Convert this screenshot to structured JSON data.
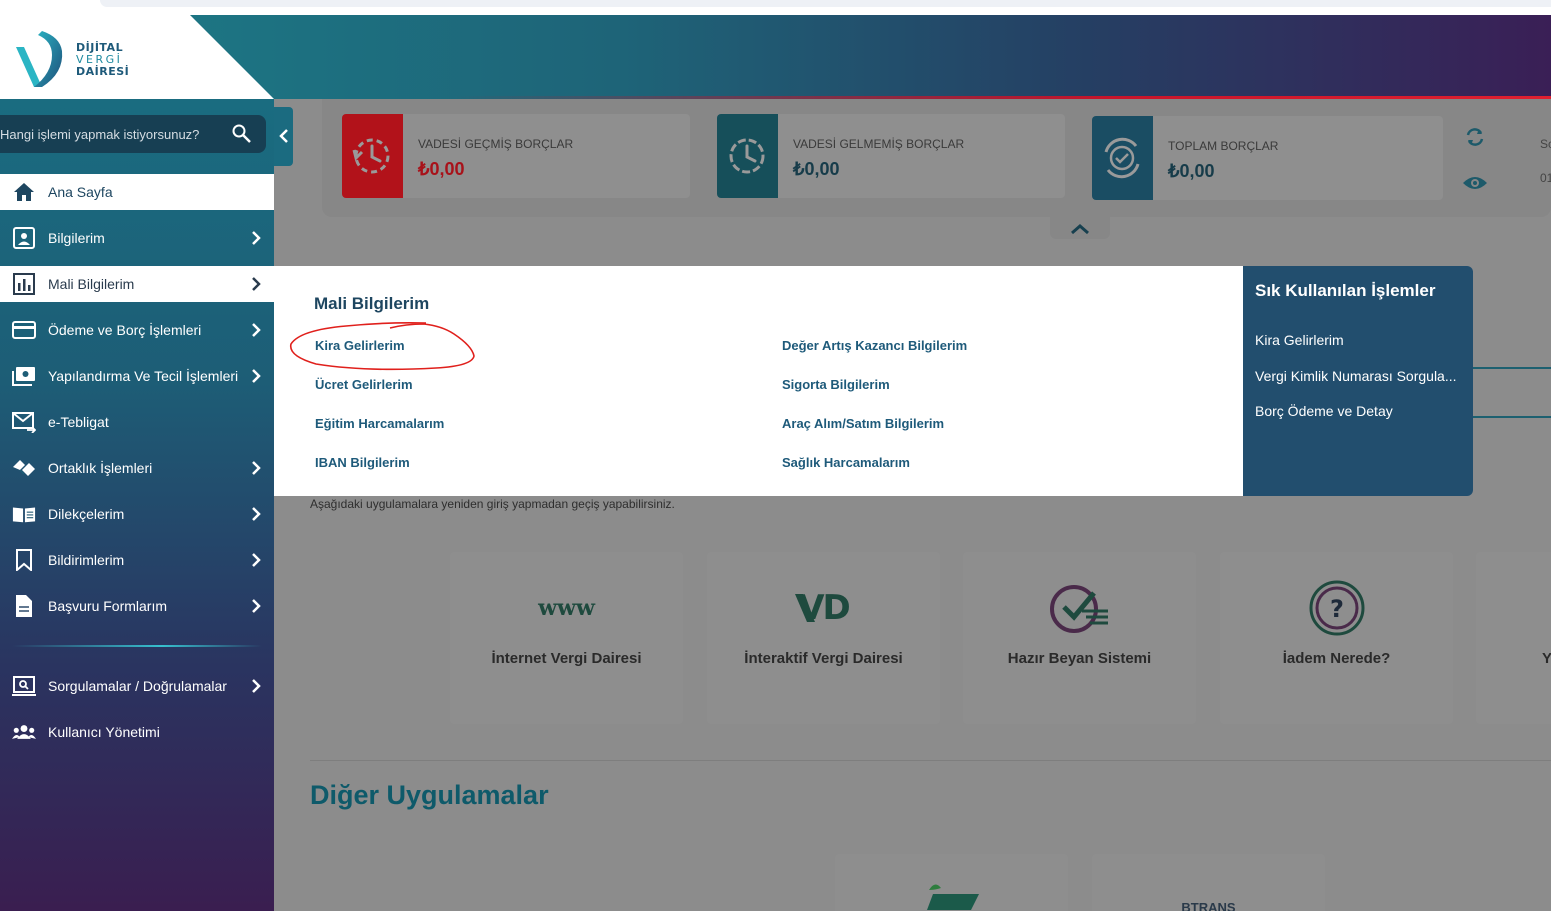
{
  "brand": {
    "line1": "DİJİTAL",
    "line2": "VERGİ",
    "line3": "DAİRESİ"
  },
  "search": {
    "placeholder": "Hangi işlemi yapmak istiyorsunuz?"
  },
  "sidebar": {
    "items": [
      {
        "label": "Ana Sayfa",
        "icon": "home-icon"
      },
      {
        "label": "Bilgilerim",
        "icon": "id-card-icon"
      },
      {
        "label": "Mali Bilgilerim",
        "icon": "bar-chart-icon"
      },
      {
        "label": "Ödeme ve Borç İşlemleri",
        "icon": "credit-card-icon"
      },
      {
        "label": "Yapılandırma Ve Tecil İşlemleri",
        "icon": "cash-icon"
      },
      {
        "label": "e-Tebligat",
        "icon": "mail-icon"
      },
      {
        "label": "Ortaklık İşlemleri",
        "icon": "handshake-icon"
      },
      {
        "label": "Dilekçelerim",
        "icon": "book-icon"
      },
      {
        "label": "Bildirimlerim",
        "icon": "bookmark-icon"
      },
      {
        "label": "Başvuru Formlarım",
        "icon": "document-icon"
      },
      {
        "label": "Sorgulamalar / Doğrulamalar",
        "icon": "search-screen-icon"
      },
      {
        "label": "Kullanıcı Yönetimi",
        "icon": "users-icon"
      }
    ]
  },
  "debts": {
    "overdue_title": "VADESİ GEÇMİŞ BORÇLAR",
    "overdue_amount": "₺0,00",
    "notdue_title": "VADESİ GELMEMİŞ BORÇLAR",
    "notdue_amount": "₺0,00",
    "total_title": "TOPLAM BORÇLAR",
    "total_amount": "₺0,00",
    "cut_1": "Sc",
    "cut_2": "01"
  },
  "mega_menu": {
    "title": "Mali Bilgilerim",
    "links": [
      "Kira Gelirlerim",
      "Ücret Gelirlerim",
      "Eğitim Harcamalarım",
      "IBAN Bilgilerim",
      "Değer Artış Kazancı Bilgilerim",
      "Sigorta Bilgilerim",
      "Araç Alım/Satım Bilgilerim",
      "Sağlık Harcamalarım"
    ]
  },
  "quick_actions": {
    "title": "Sık Kullanılan İşlemler",
    "links": [
      "Kira Gelirlerim",
      "Vergi Kimlik Numarası Sorgula...",
      "Borç Ödeme ve Detay"
    ]
  },
  "apps": {
    "hint": "Aşağıdaki uygulamalara yeniden giriş yapmadan geçiş yapabilirsiniz.",
    "cards": [
      {
        "label": "İnternet Vergi Dairesi",
        "icon_text": "www"
      },
      {
        "label": "İnteraktif Vergi Dairesi",
        "icon_text": "VD"
      },
      {
        "label": "Hazır Beyan Sistemi"
      },
      {
        "label": "İadem Nerede?"
      },
      {
        "label": "Y"
      }
    ]
  },
  "other_apps": {
    "title": "Diğer Uygulamalar",
    "btrans": "BTRANS"
  },
  "colors": {
    "overdue": "#c8141e",
    "teal": "#1e6b7a",
    "navy_text": "#1e5a7a",
    "annotation_red": "#e0201c"
  }
}
